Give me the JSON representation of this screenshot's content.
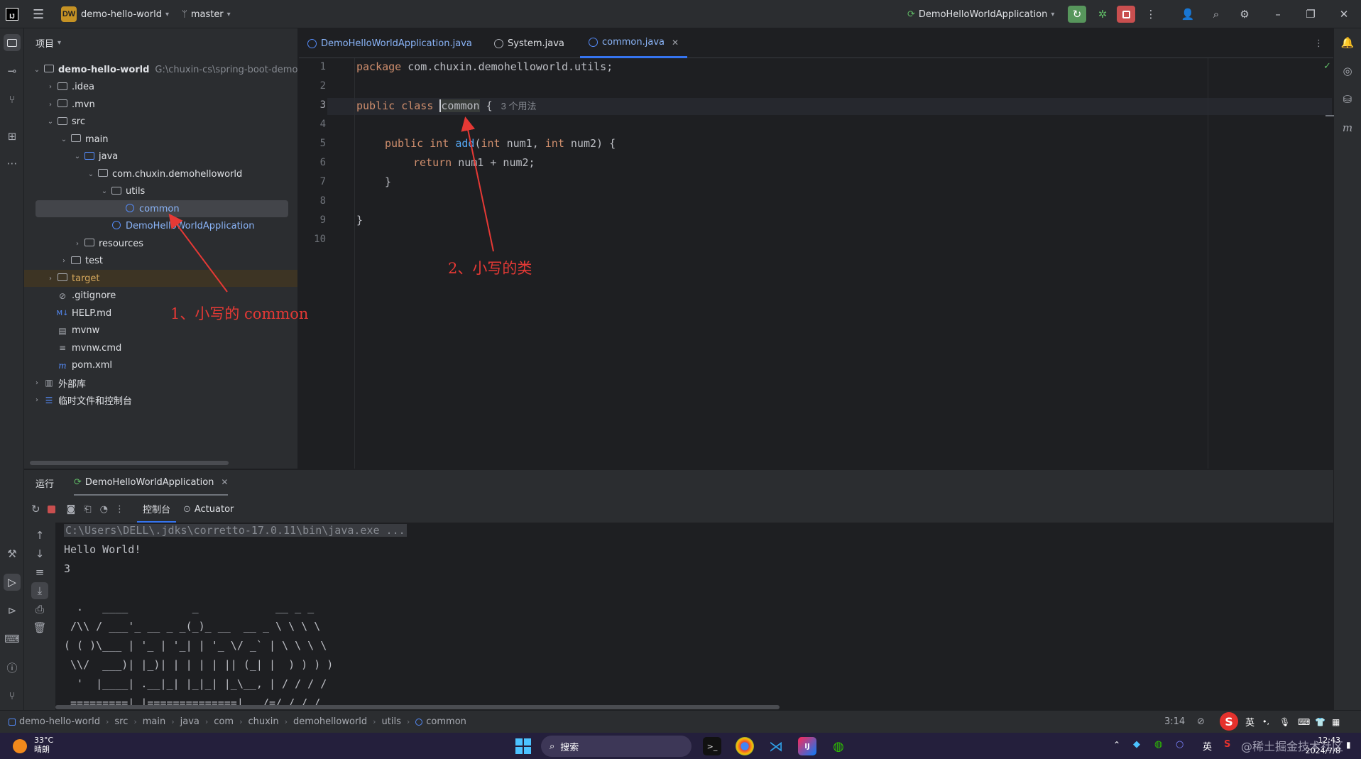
{
  "titlebar": {
    "project_badge": "DW",
    "project_name": "demo-hello-world",
    "branch": "master",
    "run_config": "DemoHelloWorldApplication"
  },
  "project_panel": {
    "header": "项目",
    "tree": [
      {
        "label": "demo-hello-world",
        "path": "G:\\chuxin-cs\\spring-boot-demo",
        "depth": 0,
        "expanded": true,
        "icon": "folder-icon",
        "bold": true
      },
      {
        "label": ".idea",
        "depth": 1,
        "expanded": false,
        "icon": "folder-icon"
      },
      {
        "label": ".mvn",
        "depth": 1,
        "expanded": false,
        "icon": "folder-icon"
      },
      {
        "label": "src",
        "depth": 1,
        "expanded": true,
        "icon": "folder-icon"
      },
      {
        "label": "main",
        "depth": 2,
        "expanded": true,
        "icon": "folder-icon"
      },
      {
        "label": "java",
        "depth": 3,
        "expanded": true,
        "icon": "folder-icon"
      },
      {
        "label": "com.chuxin.demohelloworld",
        "depth": 4,
        "expanded": true,
        "icon": "package-icon"
      },
      {
        "label": "utils",
        "depth": 5,
        "expanded": true,
        "icon": "package-icon"
      },
      {
        "label": "common",
        "depth": 6,
        "icon": "class-icon",
        "selected": true
      },
      {
        "label": "DemoHelloWorldApplication",
        "depth": 5,
        "icon": "spring-class-icon"
      },
      {
        "label": "resources",
        "depth": 3,
        "expanded": false,
        "icon": "folder-icon"
      },
      {
        "label": "test",
        "depth": 2,
        "expanded": false,
        "icon": "folder-icon"
      },
      {
        "label": "target",
        "depth": 1,
        "expanded": false,
        "icon": "folder-icon",
        "excluded": true
      },
      {
        "label": ".gitignore",
        "depth": 1,
        "icon": "ignore-file-icon"
      },
      {
        "label": "HELP.md",
        "depth": 1,
        "icon": "markdown-icon"
      },
      {
        "label": "mvnw",
        "depth": 1,
        "icon": "script-icon"
      },
      {
        "label": "mvnw.cmd",
        "depth": 1,
        "icon": "text-file-icon"
      },
      {
        "label": "pom.xml",
        "depth": 1,
        "icon": "maven-icon"
      },
      {
        "label": "外部库",
        "depth": 0,
        "expanded": false,
        "icon": "library-icon"
      },
      {
        "label": "临时文件和控制台",
        "depth": 0,
        "expanded": false,
        "icon": "scratch-icon"
      }
    ]
  },
  "editor": {
    "tabs": [
      {
        "label": "DemoHelloWorldApplication.java",
        "active": false
      },
      {
        "label": "System.java",
        "active": false
      },
      {
        "label": "common.java",
        "active": true
      }
    ],
    "line_numbers": [
      "1",
      "2",
      "3",
      "4",
      "5",
      "6",
      "7",
      "8",
      "9",
      "10"
    ],
    "current_line": "3",
    "code": {
      "l1_kw": "package",
      "l1_rest": " com.chuxin.demohelloworld.utils;",
      "l3_kw": "public class ",
      "l3_name": "common",
      "l3_rest": " {",
      "l3_inlay": "3 个用法",
      "l5_kw1": "public int ",
      "l5_fn": "add",
      "l5_rest1": "(",
      "l5_kw2": "int",
      "l5_rest2": " num1, ",
      "l5_kw3": "int",
      "l5_rest3": " num2) {",
      "l6_kw": "return",
      "l6_rest": " num1 + num2;",
      "l7": "}",
      "l9": "}"
    }
  },
  "annotations": {
    "a1": "1、小写的 common",
    "a2": "2、小写的类"
  },
  "run_panel": {
    "title": "运行",
    "run_tab": "DemoHelloWorldApplication",
    "console_tab": "控制台",
    "actuator_tab": "Actuator",
    "console_lines": [
      "C:\\Users\\DELL\\.jdks\\corretto-17.0.11\\bin\\java.exe ...",
      "Hello World!",
      "3",
      "",
      "  .   ____          _            __ _ _",
      " /\\\\ / ___'_ __ _ _(_)_ __  __ _ \\ \\ \\ \\",
      "( ( )\\___ | '_ | '_| | '_ \\/ _` | \\ \\ \\ \\",
      " \\\\/  ___)| |_)| | | | | || (_| |  ) ) ) )",
      "  '  |____| .__|_| |_|_| |_\\__, | / / / /",
      " =========|_|==============|___/=/_/_/_/"
    ]
  },
  "statusbar": {
    "breadcrumbs": [
      "demo-hello-world",
      "src",
      "main",
      "java",
      "com",
      "chuxin",
      "demohelloworld",
      "utils",
      "common"
    ],
    "caret_position": "3:14",
    "ime_lang": "英"
  },
  "taskbar": {
    "weather_temp": "33°C",
    "weather_desc": "晴朗",
    "search_placeholder": "搜索",
    "tray_lang": "英",
    "time": "12:43",
    "date": "2024/7/8",
    "watermark": "@稀土掘金技术社区"
  }
}
